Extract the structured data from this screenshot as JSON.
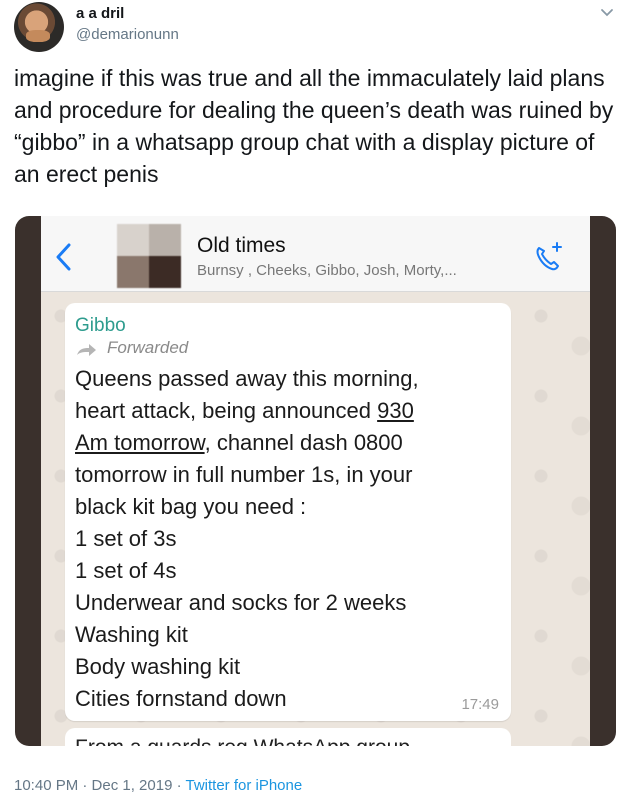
{
  "tweet": {
    "display_name": "a a dril",
    "handle": "@demarionunn",
    "text": "imagine if this was true and all the immaculately laid plans and procedure for dealing the queen’s death was ruined by “gibbo” in a whatsapp group chat with a display picture of an erect penis",
    "time": "10:40 PM · Dec 1, 2019 · ",
    "source": "Twitter for iPhone"
  },
  "chat": {
    "title": "Old times",
    "members": "Burnsy , Cheeks, Gibbo, Josh, Morty,...",
    "message": {
      "sender": "Gibbo",
      "forwarded_label": "Forwarded",
      "line1": "Queens passed away this morning,",
      "line2a": "heart attack, being announced ",
      "line2b": "930",
      "line3": "Am tomorrow",
      "line3b": ", channel dash 0800",
      "line4": "tomorrow in full number 1s, in your",
      "line5": "black kit bag you need :",
      "line6": "1 set of 3s",
      "line7": "1 set of 4s",
      "line8": "Underwear and socks for 2 weeks",
      "line9": "Washing kit",
      "line10": "Body washing kit",
      "line11": "Cities fornstand down",
      "time": "17:49"
    },
    "next_message_partial": "From a guards reg WhatsApp group"
  },
  "icons": {
    "chevron": "chevron-down-icon",
    "back": "back-arrow-icon",
    "call": "add-call-icon",
    "forward": "forward-arrow-icon"
  },
  "colors": {
    "whatsapp_accent": "#2e9c8e",
    "ios_blue": "#1a7cf5",
    "twitter_link": "#1b95e0"
  }
}
